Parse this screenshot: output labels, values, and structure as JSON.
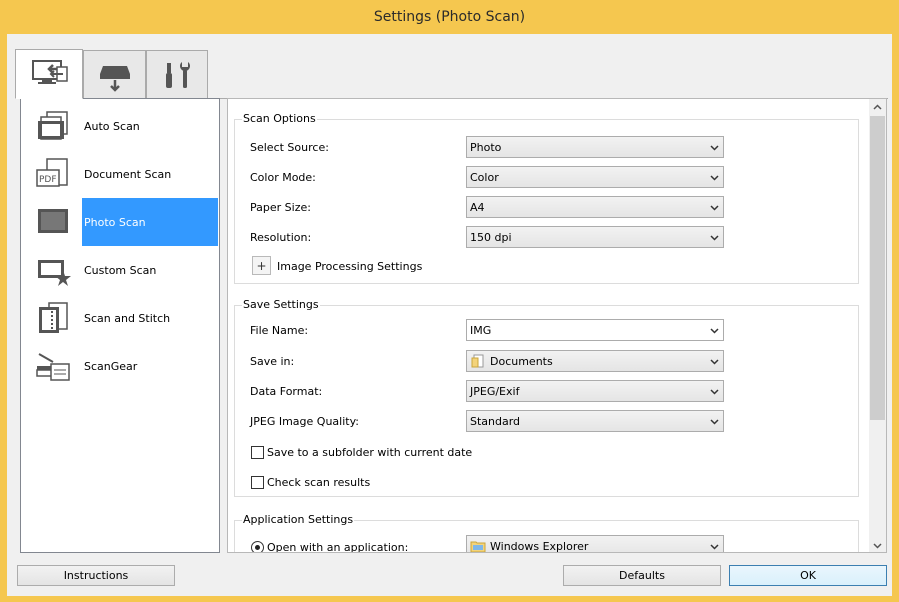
{
  "window": {
    "title": "Settings (Photo Scan)"
  },
  "tabs": [
    {
      "name": "scan-from-computer",
      "icon": "computer-scan-icon",
      "active": true
    },
    {
      "name": "scan-from-operation-panel",
      "icon": "scanner-arrow-icon",
      "active": false
    },
    {
      "name": "general-settings",
      "icon": "tools-icon",
      "active": false
    }
  ],
  "sidebar": {
    "items": [
      {
        "label": "Auto Scan",
        "icon": "auto-scan-icon",
        "selected": false
      },
      {
        "label": "Document Scan",
        "icon": "pdf-document-icon",
        "selected": false
      },
      {
        "label": "Photo Scan",
        "icon": "photo-icon",
        "selected": true
      },
      {
        "label": "Custom Scan",
        "icon": "custom-scan-star-icon",
        "selected": false
      },
      {
        "label": "Scan and Stitch",
        "icon": "stitch-icon",
        "selected": false
      },
      {
        "label": "ScanGear",
        "icon": "scanner-icon",
        "selected": false
      }
    ]
  },
  "scan_options": {
    "title": "Scan Options",
    "select_source": {
      "label": "Select Source:",
      "value": "Photo"
    },
    "color_mode": {
      "label": "Color Mode:",
      "value": "Color"
    },
    "paper_size": {
      "label": "Paper Size:",
      "value": "A4"
    },
    "resolution": {
      "label": "Resolution:",
      "value": "150 dpi"
    },
    "image_processing": {
      "expand": "+",
      "label": "Image Processing Settings"
    }
  },
  "save_settings": {
    "title": "Save Settings",
    "file_name": {
      "label": "File Name:",
      "value": "IMG"
    },
    "save_in": {
      "label": "Save in:",
      "value": "Documents"
    },
    "data_format": {
      "label": "Data Format:",
      "value": "JPEG/Exif"
    },
    "jpeg_quality": {
      "label": "JPEG Image Quality:",
      "value": "Standard"
    },
    "subfolder": {
      "label": "Save to a subfolder with current date",
      "checked": false
    },
    "check_results": {
      "label": "Check scan results",
      "checked": false
    }
  },
  "application_settings": {
    "title": "Application Settings",
    "open_with": {
      "label": "Open with an application:",
      "selected": true,
      "value": "Windows Explorer"
    }
  },
  "buttons": {
    "instructions": "Instructions",
    "defaults": "Defaults",
    "ok": "OK"
  },
  "colors": {
    "window_frame": "#f5c74f",
    "selection": "#3399ff"
  }
}
